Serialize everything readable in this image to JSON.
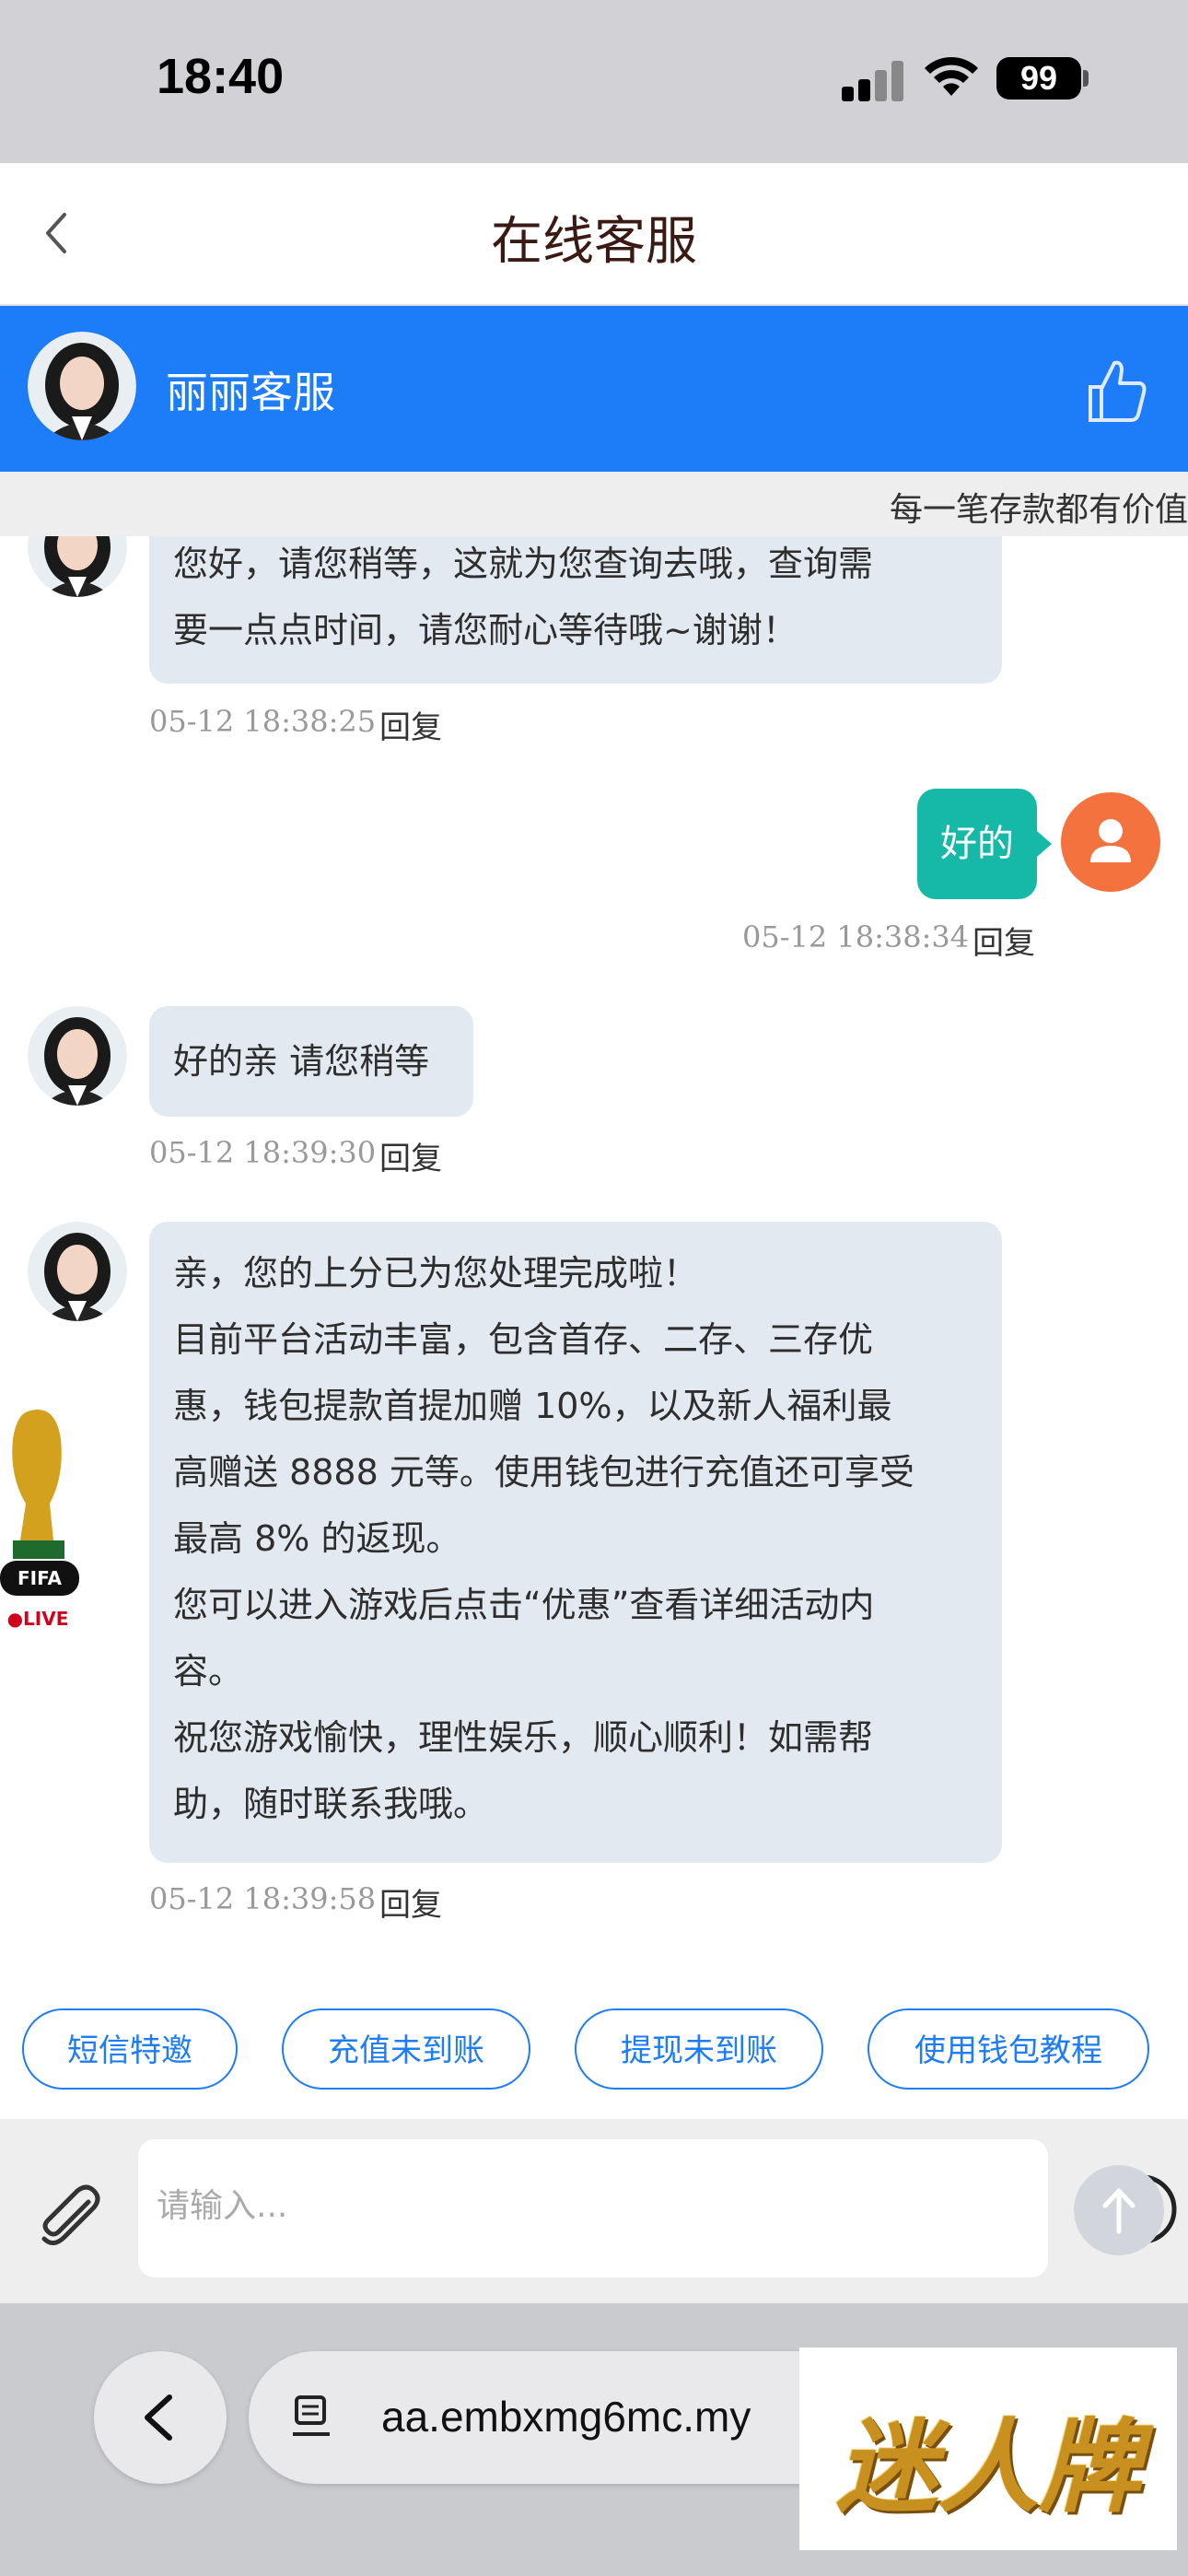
{
  "status_bar": {
    "time": "18:40",
    "battery": "99"
  },
  "header": {
    "title": "在线客服"
  },
  "agent": {
    "name": "丽丽客服"
  },
  "marquee": {
    "text": "每一笔存款都有价值"
  },
  "messages": [
    {
      "lines": [
        "您好，请您稍等，这就为您查询去哦，查询需",
        "要一点点时间，请您耐心等待哦~谢谢！"
      ],
      "time": "05-12 18:38:25",
      "reply": "回复"
    },
    {
      "user_text": "好的",
      "time": "05-12 18:38:34",
      "reply": "回复"
    },
    {
      "lines": [
        "好的亲 请您稍等"
      ],
      "time": "05-12 18:39:30",
      "reply": "回复"
    },
    {
      "lines": [
        "亲，您的上分已为您处理完成啦！",
        "目前平台活动丰富，包含首存、二存、三存优",
        "惠，钱包提款首提加赠 10%，以及新人福利最",
        "高赠送 8888 元等。使用钱包进行充值还可享受",
        "最高 8% 的返现。",
        "您可以进入游戏后点击“优惠”查看详细活动内",
        "容。",
        "祝您游戏愉快，理性娱乐，顺心顺利！如需帮",
        "助，随时联系我哦。"
      ],
      "time": "05-12 18:39:58",
      "reply": "回复"
    }
  ],
  "widget": {
    "brand": "FIFA",
    "live": "●LIVE"
  },
  "quick_replies": [
    "短信特邀",
    "充值未到账",
    "提现未到账",
    "使用钱包教程"
  ],
  "input": {
    "placeholder": "请输入..."
  },
  "browser": {
    "url": "aa.embxmg6mc.my"
  },
  "logo": {
    "text": "迷人牌"
  },
  "colors": {
    "brand_blue": "#1d7cf7",
    "user_bubble": "#16b9a8",
    "user_avatar": "#f3723d",
    "agent_bubble": "#e3e9f1"
  }
}
